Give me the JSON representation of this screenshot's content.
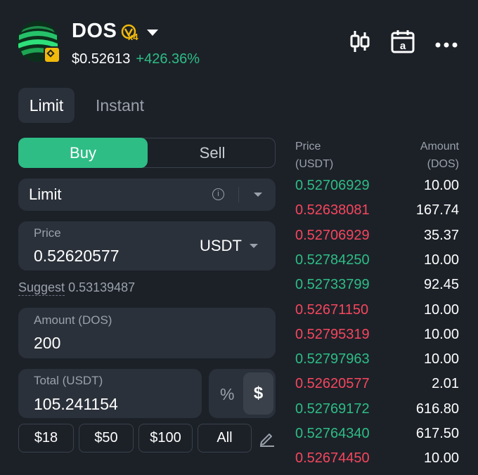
{
  "token": {
    "name": "DOS",
    "leverage_badge": "x4",
    "price": "$0.52613",
    "change": "+426.36%"
  },
  "tabs": [
    {
      "label": "Limit",
      "active": true
    },
    {
      "label": "Instant",
      "active": false
    }
  ],
  "side": {
    "buy_label": "Buy",
    "sell_label": "Sell",
    "selected": "Buy"
  },
  "order_type": {
    "label": "Limit"
  },
  "price_field": {
    "label": "Price",
    "value": "0.52620577",
    "currency": "USDT"
  },
  "suggest": {
    "label": "Suggest",
    "value": "0.53139487"
  },
  "amount_field": {
    "label": "Amount (DOS)",
    "value": "200"
  },
  "total_field": {
    "label": "Total (USDT)",
    "value": "105.241154",
    "pct_label": "%",
    "dollar_label": "$"
  },
  "quick_amounts": [
    "$18",
    "$50",
    "$100",
    "All"
  ],
  "order_book": {
    "price_header": [
      "Price",
      "(USDT)"
    ],
    "amount_header": [
      "Amount",
      "(DOS)"
    ],
    "rows": [
      {
        "price": "0.52706929",
        "amount": "10.00",
        "side": "green"
      },
      {
        "price": "0.52638081",
        "amount": "167.74",
        "side": "red"
      },
      {
        "price": "0.52706929",
        "amount": "35.37",
        "side": "red"
      },
      {
        "price": "0.52784250",
        "amount": "10.00",
        "side": "green"
      },
      {
        "price": "0.52733799",
        "amount": "92.45",
        "side": "green"
      },
      {
        "price": "0.52671150",
        "amount": "10.00",
        "side": "red"
      },
      {
        "price": "0.52795319",
        "amount": "10.00",
        "side": "red"
      },
      {
        "price": "0.52797963",
        "amount": "10.00",
        "side": "green"
      },
      {
        "price": "0.52620577",
        "amount": "2.01",
        "side": "red"
      },
      {
        "price": "0.52769172",
        "amount": "616.80",
        "side": "green"
      },
      {
        "price": "0.52764340",
        "amount": "617.50",
        "side": "green"
      },
      {
        "price": "0.52674450",
        "amount": "10.00",
        "side": "red"
      }
    ]
  },
  "icons": {
    "chart": "candlestick-chart-icon",
    "calendar": "calendar-icon",
    "more": "more-icon",
    "info": "info-icon",
    "edit": "pencil-icon"
  },
  "colors": {
    "up": "#2ebd85",
    "down": "#f6465d",
    "background": "#1c2128",
    "surface": "#2b313a"
  }
}
